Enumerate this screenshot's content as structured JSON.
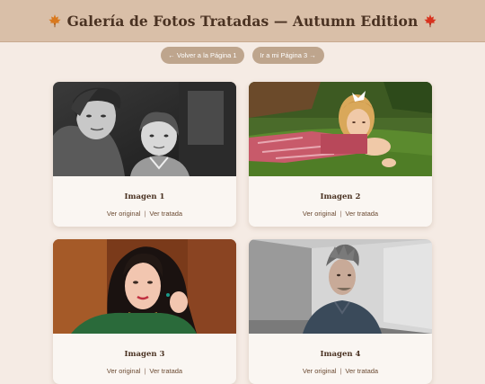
{
  "header": {
    "title": "Galería de Fotos Tratadas — Autumn Edition",
    "left_icon": "maple-leaf-icon-orange",
    "right_icon": "maple-leaf-icon-red"
  },
  "nav": {
    "back_label": "← Volver a la Página 1",
    "next_label": "Ir a mi Página 3 →"
  },
  "cards": [
    {
      "title": "Imagen 1",
      "original_label": "Ver original",
      "separator": "|",
      "treated_label": "Ver tratada"
    },
    {
      "title": "Imagen 2",
      "original_label": "Ver original",
      "separator": "|",
      "treated_label": "Ver tratada"
    },
    {
      "title": "Imagen 3",
      "original_label": "Ver original",
      "separator": "|",
      "treated_label": "Ver tratada"
    },
    {
      "title": "Imagen 4",
      "original_label": "Ver original",
      "separator": "|",
      "treated_label": "Ver tratada"
    }
  ],
  "colors": {
    "page_background": "#f5ebe4",
    "header_background": "#d9bfa8",
    "button_background": "#bea58d",
    "title_text": "#4a3222"
  }
}
